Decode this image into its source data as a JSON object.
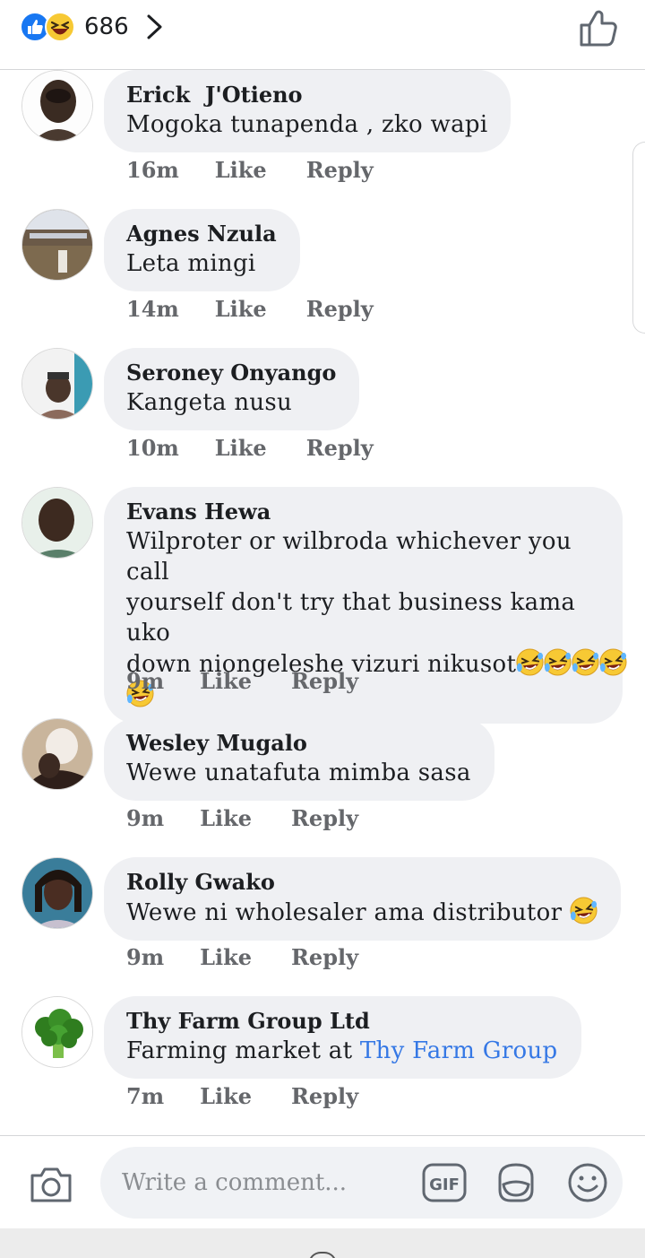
{
  "header": {
    "reaction_count": "686",
    "reaction_types": [
      "like-icon",
      "haha-icon"
    ]
  },
  "comments": [
    {
      "name": "Erick  J'Otieno",
      "text": "Mogoka tunapenda , zko wapi",
      "time": "16m",
      "like": "Like",
      "reply": "Reply"
    },
    {
      "name": "Agnes Nzula",
      "text": "Leta mingi",
      "time": "14m",
      "like": "Like",
      "reply": "Reply"
    },
    {
      "name": "Seroney Onyango",
      "text": "Kangeta nusu",
      "time": "10m",
      "like": "Like",
      "reply": "Reply"
    },
    {
      "name": "Evans Hewa",
      "text_lines": [
        "Wilproter or wilbroda whichever you call",
        "yourself don't try that business kama uko",
        "down niongeleshe vizuri nikusot"
      ],
      "emoji_count": 5,
      "time": "9m",
      "like": "Like",
      "reply": "Reply"
    },
    {
      "name": "Wesley Mugalo",
      "text": "Wewe unatafuta mimba sasa",
      "time": "9m",
      "like": "Like",
      "reply": "Reply"
    },
    {
      "name": "Rolly Gwako",
      "text": "Wewe ni wholesaler ama distributor ",
      "time": "9m",
      "like": "Like",
      "reply": "Reply"
    },
    {
      "name": "Thy Farm Group Ltd",
      "text": "Farming market at ",
      "link": "Thy Farm Group",
      "time": "7m",
      "like": "Like",
      "reply": "Reply"
    }
  ],
  "composer": {
    "placeholder": "Write a comment..."
  },
  "colors": {
    "accent": "#1877f2",
    "link": "#3578e5",
    "bubble": "#eff0f3",
    "meta": "#65676b"
  }
}
